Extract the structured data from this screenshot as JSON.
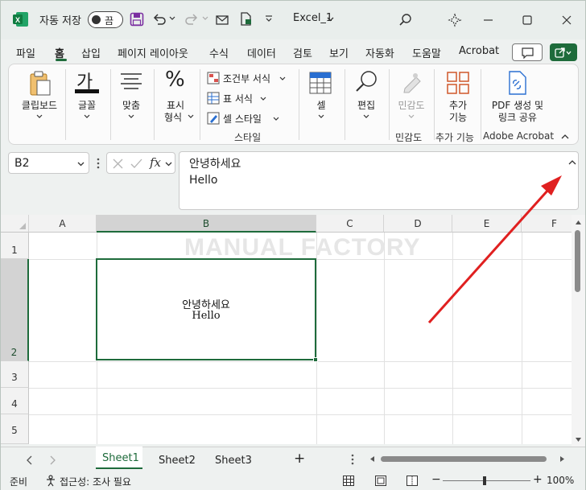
{
  "titlebar": {
    "autosave_label": "자동 저장",
    "autosave_state": "끔",
    "filename": "Excel_1"
  },
  "tabs": [
    "파일",
    "홈",
    "삽입",
    "페이지 레이아웃",
    "수식",
    "데이터",
    "검토",
    "보기",
    "자동화",
    "도움말",
    "Acrobat"
  ],
  "active_tab": "홈",
  "ribbon": {
    "clipboard": "클립보드",
    "font": "글꼴",
    "font_glyph": "가",
    "align": "맞춤",
    "number_line1": "표시",
    "number_line2": "형식",
    "conditional": "조건부 서식",
    "table_format": "표 서식",
    "cell_style": "셀 스타일",
    "styles_group": "스타일",
    "cells": "셀",
    "editing": "편집",
    "sensitivity": "민감도",
    "sensitivity_group": "민감도",
    "addins_line1": "추가",
    "addins_line2": "기능",
    "addins_group": "추가 기능",
    "pdf_line1": "PDF 생성 및",
    "pdf_line2": "링크 공유",
    "acrobat_group": "Adobe Acrobat"
  },
  "formula": {
    "namebox": "B2",
    "fx": "fx",
    "line1": "안녕하세요",
    "line2": "Hello"
  },
  "grid": {
    "columns": [
      "A",
      "B",
      "C",
      "D",
      "E",
      "F"
    ],
    "rows": [
      "1",
      "2",
      "3",
      "4",
      "5"
    ],
    "selected_cell": "B2",
    "cell_b2_line1": "안녕하세요",
    "cell_b2_line2": "Hello",
    "watermark": "MANUAL FACTORY"
  },
  "sheets": [
    "Sheet1",
    "Sheet2",
    "Sheet3"
  ],
  "active_sheet": "Sheet1",
  "add_sheet": "+",
  "status": {
    "ready": "준비",
    "accessibility": "접근성: 조사 필요",
    "zoom": "100%"
  },
  "colors": {
    "accent": "#1e6b3b",
    "arrow": "#e02020"
  }
}
